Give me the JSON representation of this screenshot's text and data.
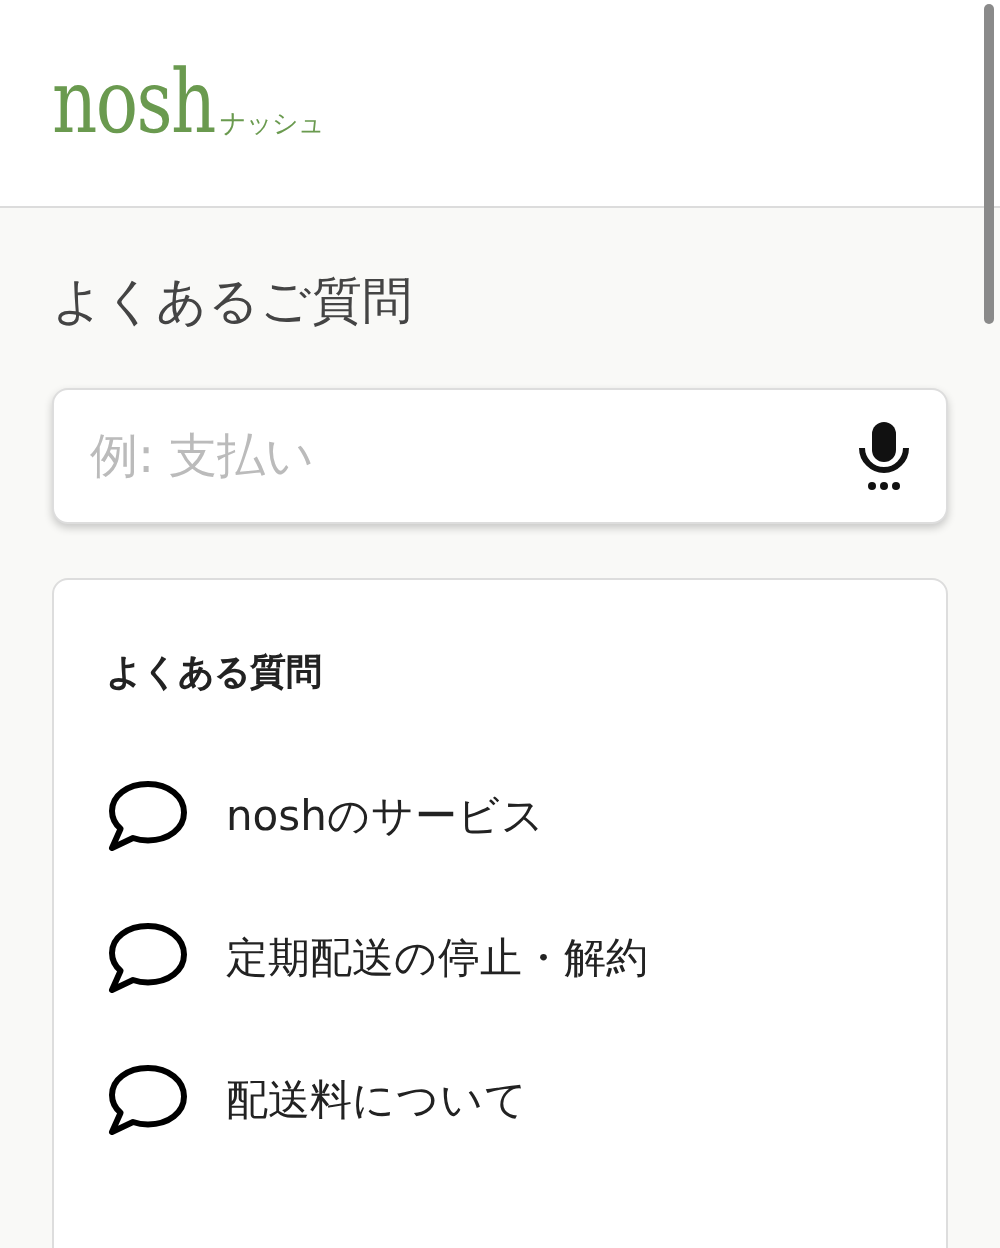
{
  "header": {
    "logo": "nosh",
    "logo_reading": "ナッシュ"
  },
  "page_title": "よくあるご質問",
  "search": {
    "placeholder": "例: 支払い"
  },
  "faq": {
    "heading": "よくある質問",
    "items": [
      {
        "label": "noshのサービス"
      },
      {
        "label": "定期配送の停止・解約"
      },
      {
        "label": "配送料について"
      }
    ]
  }
}
